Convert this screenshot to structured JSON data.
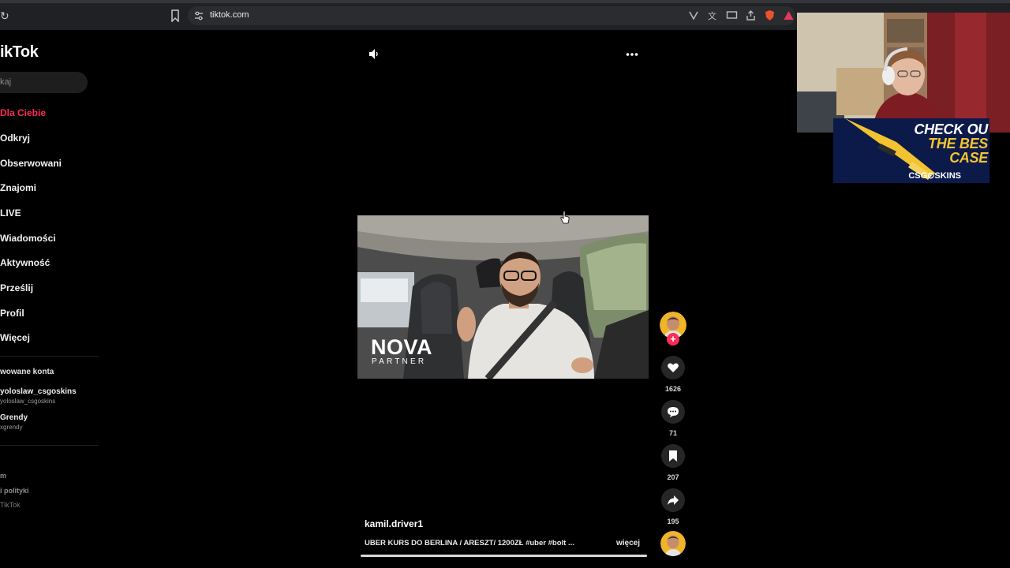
{
  "browser": {
    "url": "tiktok.com"
  },
  "sidebar": {
    "logo": "ikTok",
    "search_placeholder": "kaj",
    "nav": [
      {
        "label": "Dla Ciebie",
        "active": true
      },
      {
        "label": "Odkryj"
      },
      {
        "label": "Obserwowani"
      },
      {
        "label": "Znajomi"
      },
      {
        "label": "LIVE"
      },
      {
        "label": "Wiadomości"
      },
      {
        "label": "Aktywność"
      },
      {
        "label": "Prześlij"
      },
      {
        "label": "Profil"
      },
      {
        "label": "Więcej"
      }
    ],
    "section_title": "wowane konta",
    "accounts": [
      {
        "name": "yoloslaw_csgoskins",
        "handle": "yoloslaw_csgoskins"
      },
      {
        "name": "Grendy",
        "handle": "xgrendy"
      }
    ],
    "footer": [
      "m",
      "i polityki",
      "TikTok"
    ]
  },
  "video": {
    "brand": "NOVA",
    "brand_sub": "PARTNER",
    "author": "kamil.driver1",
    "description": "UBER KURS DO BERLINA / ARESZT/ 1200ZŁ #uber #bolt ...",
    "more": "więcej",
    "progress": 1.0
  },
  "actions": {
    "likes": "1626",
    "comments": "71",
    "saves": "207",
    "shares": "195",
    "follow_symbol": "+"
  },
  "ad": {
    "line1": "CHECK OU",
    "line2": "THE BES",
    "line3": "CASE",
    "brand": "CSG⊙SKINS"
  },
  "colors": {
    "accent": "#fe2c55",
    "background": "#000000"
  }
}
